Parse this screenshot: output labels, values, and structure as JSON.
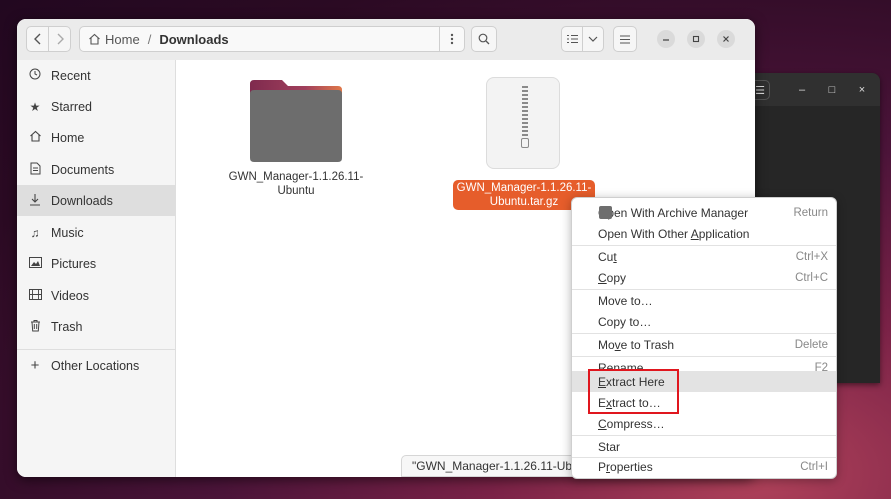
{
  "background_window": {
    "controls": [
      "☰",
      "–",
      "□",
      "×"
    ]
  },
  "header": {
    "path_home": "Home",
    "path_separator": "/",
    "path_current": "Downloads"
  },
  "sidebar": {
    "items": [
      {
        "label": "Recent",
        "icon": "clock-icon"
      },
      {
        "label": "Starred",
        "icon": "star-icon"
      },
      {
        "label": "Home",
        "icon": "home-icon"
      },
      {
        "label": "Documents",
        "icon": "document-icon"
      },
      {
        "label": "Downloads",
        "icon": "download-icon"
      },
      {
        "label": "Music",
        "icon": "music-icon"
      },
      {
        "label": "Pictures",
        "icon": "picture-icon"
      },
      {
        "label": "Videos",
        "icon": "video-icon"
      },
      {
        "label": "Trash",
        "icon": "trash-icon"
      },
      {
        "label": "Other Locations",
        "icon": "plus-icon"
      }
    ]
  },
  "files": {
    "folder": {
      "line1": "GWN_Manager-1.1.26.11-",
      "line2": "Ubuntu"
    },
    "archive": {
      "line1": "GWN_Manager-1.1.26.11-",
      "line2": "Ubuntu.tar.gz"
    }
  },
  "statusbar": {
    "text": "\"GWN_Manager-1.1.26.11-Ubuntu.tar.gz\" selected"
  },
  "context_menu": {
    "open_archive": {
      "label": "Open With Archive Manager",
      "accel": "Return"
    },
    "open_other": {
      "pre": "Open With Other ",
      "u": "A",
      "post": "pplication"
    },
    "cut": {
      "pre": "Cu",
      "u": "t",
      "post": "",
      "accel": "Ctrl+X"
    },
    "copy": {
      "pre": "",
      "u": "C",
      "post": "opy",
      "accel": "Ctrl+C"
    },
    "move_to": {
      "label": "Move to…"
    },
    "copy_to": {
      "label": "Copy to…"
    },
    "move_trash": {
      "pre": "Mo",
      "u": "v",
      "post": "e to Trash",
      "accel": "Delete"
    },
    "rename": {
      "pre": "Rena",
      "u": "m",
      "post": "e…",
      "accel": "F2"
    },
    "extract_here": {
      "pre": "",
      "u": "E",
      "post": "xtract Here"
    },
    "extract_to": {
      "pre": "E",
      "u": "x",
      "post": "tract to…"
    },
    "compress": {
      "pre": "",
      "u": "C",
      "post": "ompress…"
    },
    "star": {
      "label": "Star"
    },
    "properties": {
      "pre": "P",
      "u": "r",
      "post": "operties",
      "accel": "Ctrl+I"
    }
  },
  "colors": {
    "selection": "#e65d2b",
    "highlight_box": "#e0161e",
    "folder_top": "#8e2f55",
    "folder_body": "#6d6d6d"
  }
}
